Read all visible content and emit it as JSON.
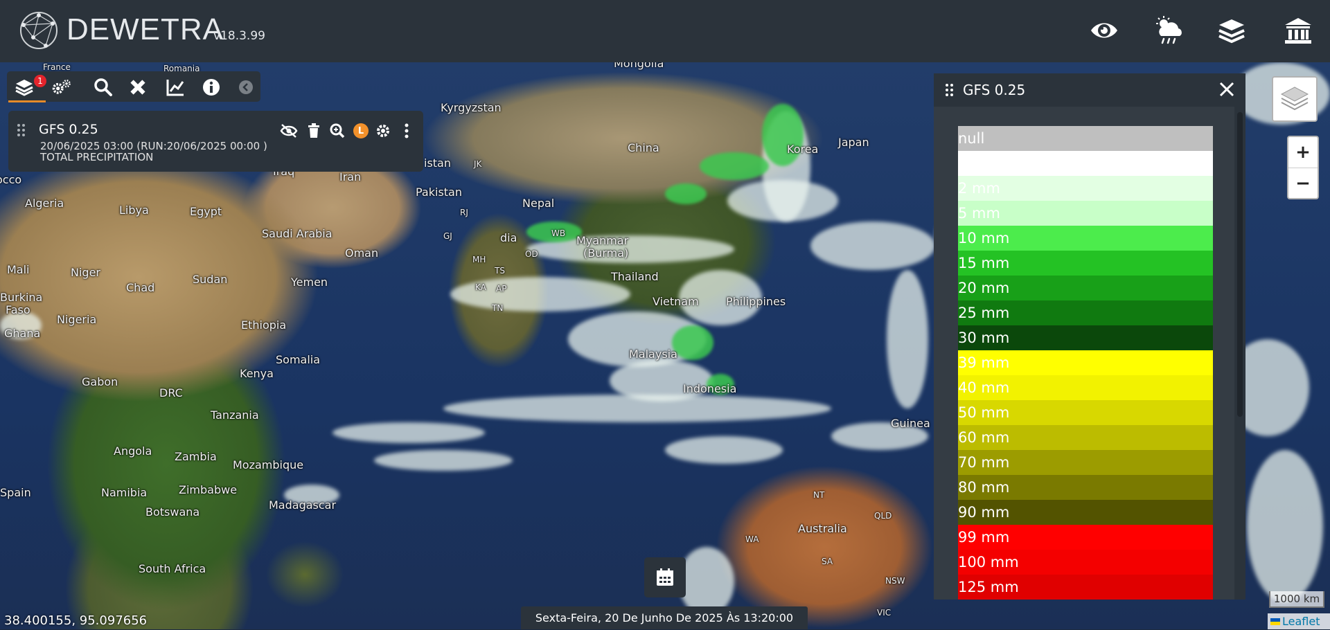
{
  "header": {
    "brand": "DEWETRA",
    "version": "v18.3.99",
    "icons": [
      "eye-icon",
      "weather-icon",
      "layers-stack-icon",
      "institution-icon"
    ]
  },
  "toolbar": {
    "badge_count": "1",
    "icons": [
      "layers-icon",
      "settings-icon",
      "search-icon",
      "tools-icon",
      "chart-icon",
      "info-icon",
      "collapse-icon"
    ]
  },
  "layer": {
    "name": "GFS 0.25",
    "datetime": "20/06/2025 03:00 (RUN:20/06/2025 00:00 )",
    "variable": "TOTAL PRECIPITATION",
    "badge": "L"
  },
  "legend": {
    "title": "GFS 0.25",
    "items": [
      {
        "label": "null",
        "color": "#bfbfbf"
      },
      {
        "label": "",
        "color": "#ffffff"
      },
      {
        "label": "2 mm",
        "color": "#e3ffe3"
      },
      {
        "label": "5 mm",
        "color": "#c8ffc8"
      },
      {
        "label": "10 mm",
        "color": "#4cec4c"
      },
      {
        "label": "15 mm",
        "color": "#24c224"
      },
      {
        "label": "20 mm",
        "color": "#18a018"
      },
      {
        "label": "25 mm",
        "color": "#107a10"
      },
      {
        "label": "30 mm",
        "color": "#0b480b"
      },
      {
        "label": "39 mm",
        "color": "#ffff00"
      },
      {
        "label": "40 mm",
        "color": "#f2f200"
      },
      {
        "label": "50 mm",
        "color": "#d8d800"
      },
      {
        "label": "60 mm",
        "color": "#bcbc00"
      },
      {
        "label": "70 mm",
        "color": "#9c9c00"
      },
      {
        "label": "80 mm",
        "color": "#7a7a00"
      },
      {
        "label": "90 mm",
        "color": "#535300"
      },
      {
        "label": "99 mm",
        "color": "#ff0000"
      },
      {
        "label": "100 mm",
        "color": "#f40000"
      },
      {
        "label": "125 mm",
        "color": "#e00000"
      }
    ]
  },
  "map": {
    "coordinates": "38.400155, 95.097656",
    "date_text": "Sexta-Feira, 20 De Junho De 2025 Às 13:20:00",
    "scale": "1000 km",
    "attribution": "Leaflet",
    "labels": {
      "france": "France",
      "romania": "Romania",
      "mongolia": "Mongolia",
      "kyrgyzstan": "Kyrgyzstan",
      "china": "China",
      "korea": "Korea",
      "japan": "Japan",
      "iraq": "Iraq",
      "iran": "Iran",
      "pakistan": "Pakistan",
      "istan": "istan",
      "jk": "JK",
      "rj": "RJ",
      "gj": "GJ",
      "mh": "MH",
      "ts": "TS",
      "ka": "KA",
      "ap": "AP",
      "tn": "TN",
      "od": "OD",
      "wb": "WB",
      "nepal": "Nepal",
      "india": "dia",
      "myanmar": "Myanmar",
      "burma": "(Burma)",
      "thailand": "Thailand",
      "vietnam": "Vietnam",
      "philippines": "Philippines",
      "malaysia": "Malaysia",
      "indonesia": "Indonesia",
      "guinea": "Guinea",
      "algeria": "Algeria",
      "libya": "Libya",
      "egypt": "Egypt",
      "saudi": "Saudi Arabia",
      "oman": "Oman",
      "yemen": "Yemen",
      "mali": "Mali",
      "niger": "Niger",
      "chad": "Chad",
      "sudan": "Sudan",
      "burkina": "Burkina",
      "faso": "Faso",
      "ghana": "Ghana",
      "nigeria": "Nigeria",
      "ethiopia": "Ethiopia",
      "somalia": "Somalia",
      "kenya": "Kenya",
      "gabon": "Gabon",
      "drc": "DRC",
      "tanzania": "Tanzania",
      "angola": "Angola",
      "zambia": "Zambia",
      "mozambique": "Mozambique",
      "namibia": "Namibia",
      "zimbabwe": "Zimbabwe",
      "botswana": "Botswana",
      "madagascar": "Madagascar",
      "southafrica": "South Africa",
      "morocco": "occo",
      "spain": "Spain",
      "australia": "Australia",
      "nt": "NT",
      "qld": "QLD",
      "wa": "WA",
      "sa": "SA",
      "nsw": "NSW",
      "vic": "VIC"
    }
  },
  "controls": {
    "zoom_in": "+",
    "zoom_out": "−"
  }
}
